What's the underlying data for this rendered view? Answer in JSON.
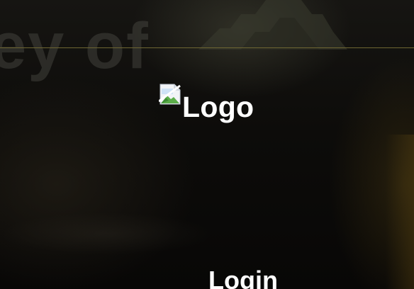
{
  "background": {
    "headline_text": "ey of",
    "accent_line_color": "#6e6633"
  },
  "logo": {
    "alt_text": "Logo",
    "icon": "broken-image-icon"
  },
  "login": {
    "heading": "Login"
  },
  "colors": {
    "text": "#ffffff",
    "background": "#0b0a08"
  }
}
